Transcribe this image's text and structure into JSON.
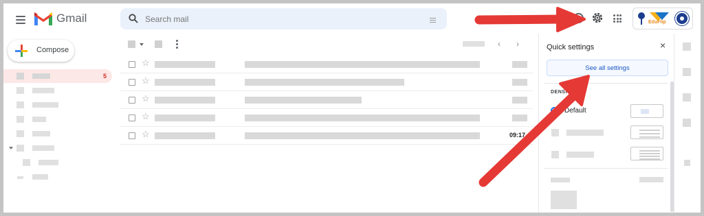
{
  "header": {
    "brand": "Gmail",
    "search_placeholder": "Search mail",
    "org_text": "EduFlip"
  },
  "sidebar": {
    "compose_label": "Compose",
    "inbox_count": "5"
  },
  "mail_list": {
    "rows": [
      {
        "time": ""
      },
      {
        "time": ""
      },
      {
        "time": ""
      },
      {
        "time": ""
      },
      {
        "time": "09:17"
      }
    ]
  },
  "quick_settings": {
    "title": "Quick settings",
    "close_symbol": "×",
    "see_all_label": "See all settings",
    "density_heading": "DENSITY",
    "density_default": "Default"
  },
  "pager": {
    "prev": "‹",
    "next": "›"
  },
  "colors": {
    "accent": "#1a73e8",
    "arrow": "#e53935",
    "badge": "#d93025"
  }
}
